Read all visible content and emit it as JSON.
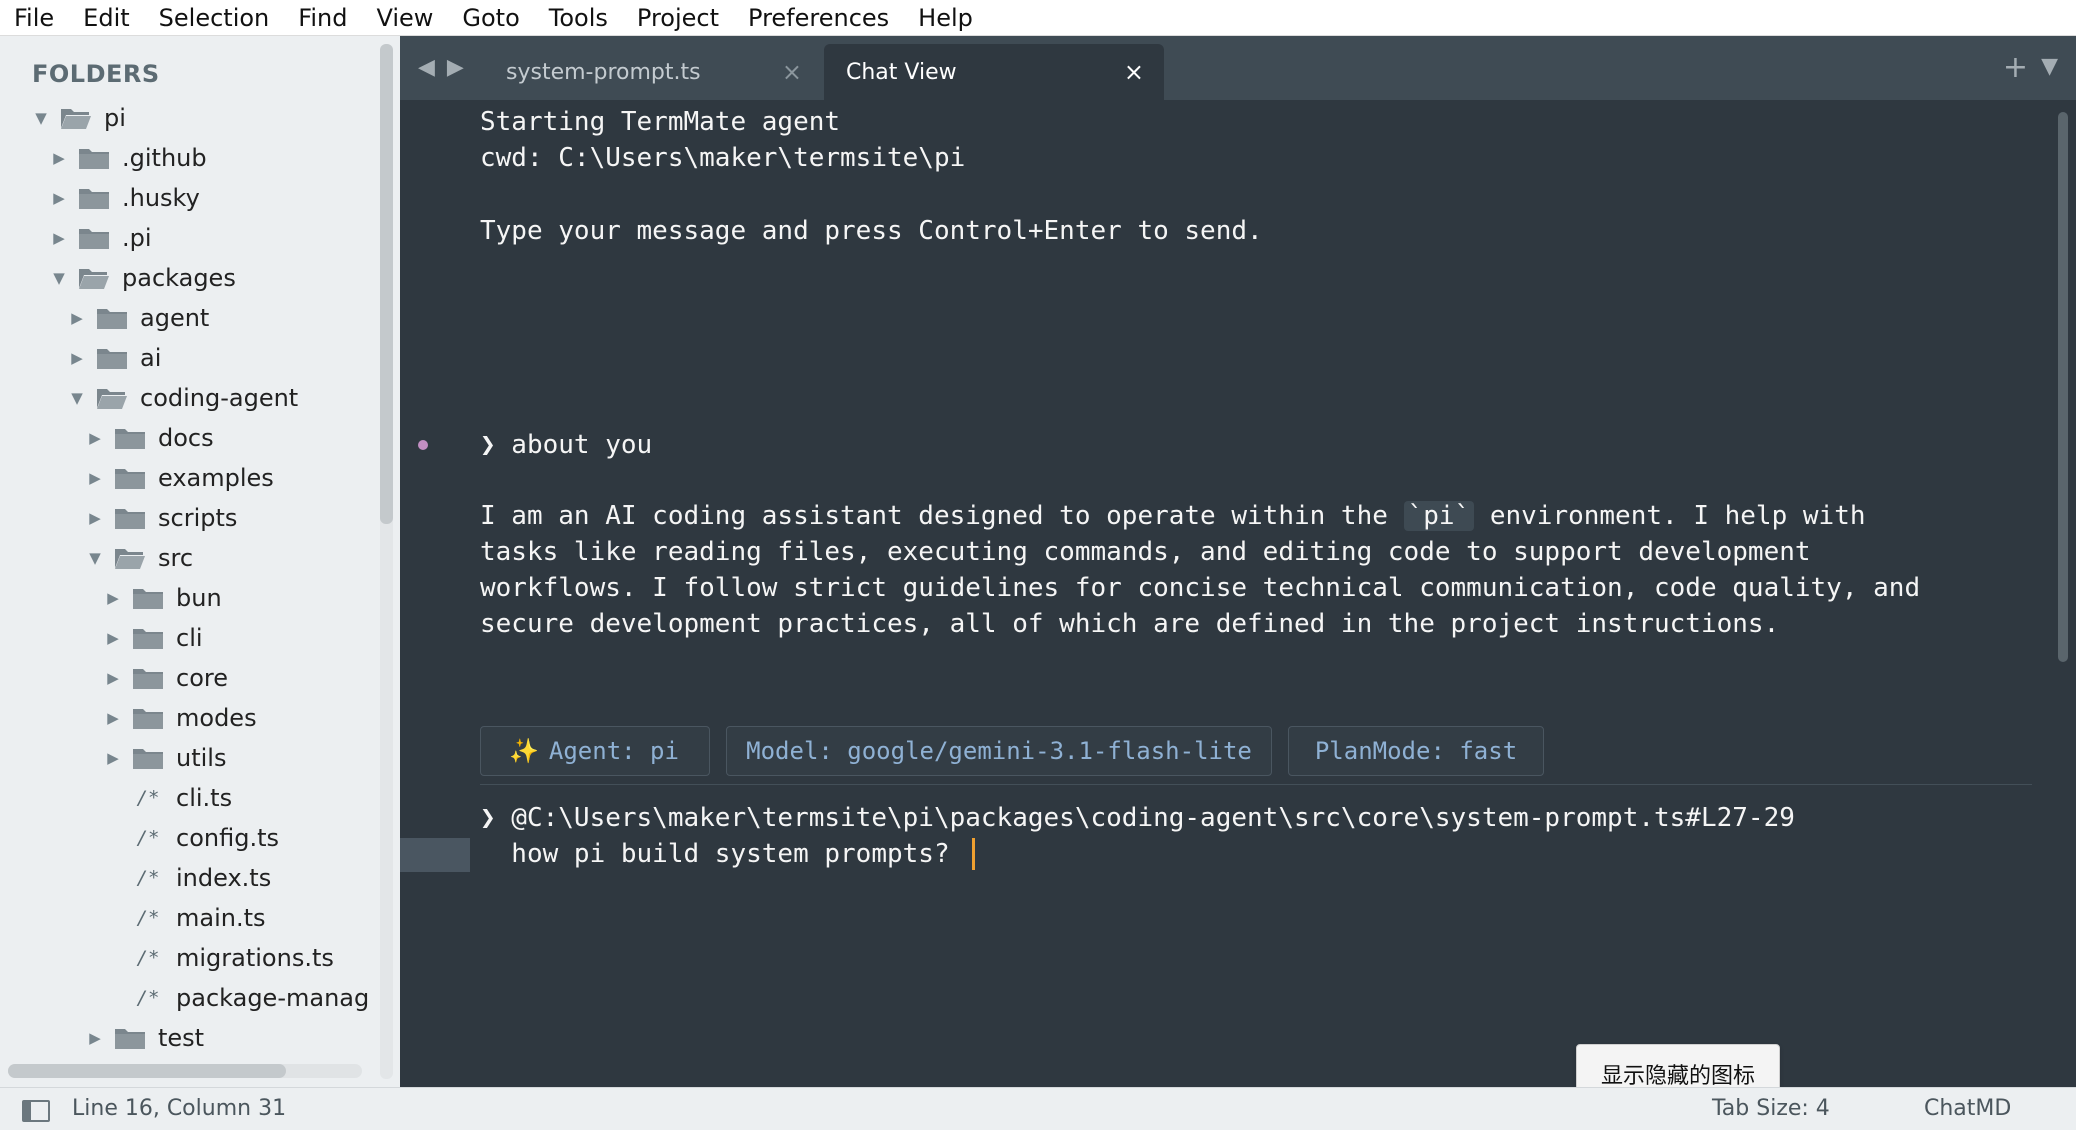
{
  "menu": [
    "File",
    "Edit",
    "Selection",
    "Find",
    "View",
    "Goto",
    "Tools",
    "Project",
    "Preferences",
    "Help"
  ],
  "sidebar": {
    "title": "FOLDERS",
    "tree": [
      {
        "label": "pi",
        "type": "folder",
        "depth": 0,
        "expanded": true
      },
      {
        "label": ".github",
        "type": "folder",
        "depth": 1,
        "expanded": false
      },
      {
        "label": ".husky",
        "type": "folder",
        "depth": 1,
        "expanded": false
      },
      {
        "label": ".pi",
        "type": "folder",
        "depth": 1,
        "expanded": false
      },
      {
        "label": "packages",
        "type": "folder",
        "depth": 1,
        "expanded": true
      },
      {
        "label": "agent",
        "type": "folder",
        "depth": 2,
        "expanded": false
      },
      {
        "label": "ai",
        "type": "folder",
        "depth": 2,
        "expanded": false
      },
      {
        "label": "coding-agent",
        "type": "folder",
        "depth": 2,
        "expanded": true
      },
      {
        "label": "docs",
        "type": "folder",
        "depth": 3,
        "expanded": false
      },
      {
        "label": "examples",
        "type": "folder",
        "depth": 3,
        "expanded": false
      },
      {
        "label": "scripts",
        "type": "folder",
        "depth": 3,
        "expanded": false
      },
      {
        "label": "src",
        "type": "folder",
        "depth": 3,
        "expanded": true
      },
      {
        "label": "bun",
        "type": "folder",
        "depth": 4,
        "expanded": false
      },
      {
        "label": "cli",
        "type": "folder",
        "depth": 4,
        "expanded": false
      },
      {
        "label": "core",
        "type": "folder",
        "depth": 4,
        "expanded": false
      },
      {
        "label": "modes",
        "type": "folder",
        "depth": 4,
        "expanded": false
      },
      {
        "label": "utils",
        "type": "folder",
        "depth": 4,
        "expanded": false
      },
      {
        "label": "cli.ts",
        "type": "file",
        "depth": 4
      },
      {
        "label": "config.ts",
        "type": "file",
        "depth": 4
      },
      {
        "label": "index.ts",
        "type": "file",
        "depth": 4
      },
      {
        "label": "main.ts",
        "type": "file",
        "depth": 4
      },
      {
        "label": "migrations.ts",
        "type": "file",
        "depth": 4
      },
      {
        "label": "package-manag",
        "type": "file",
        "depth": 4
      },
      {
        "label": "test",
        "type": "folder",
        "depth": 3,
        "expanded": false
      }
    ],
    "file_icon_glyph": "/*"
  },
  "tabs": {
    "nav_back": "◀",
    "nav_forward": "▶",
    "items": [
      {
        "label": "system-prompt.ts",
        "active": false,
        "close": "×"
      },
      {
        "label": "Chat View",
        "active": true,
        "close": "×"
      }
    ],
    "add": "+",
    "dropdown": "▼"
  },
  "editor": {
    "line_start": "Starting TermMate agent",
    "line_cwd": "cwd: C:\\Users\\maker\\termsite\\pi",
    "line_hint": "Type your message and press Control+Enter to send.",
    "question_prompt": "❯ about you",
    "answer": {
      "l1_pre": "I am an AI coding assistant designed to operate within the ",
      "l1_code": "`pi`",
      "l1_post": " environment. I help with",
      "l2": "tasks like reading files, executing commands, and editing code to support development",
      "l3": "workflows. I follow strict guidelines for concise technical communication, code quality, and",
      "l4": "secure development practices, all of which are defined in the project instructions."
    },
    "info": {
      "sparkle": "✨",
      "agent": "Agent: pi",
      "model": "Model: google/gemini-3.1-flash-lite",
      "plan": "PlanMode: fast"
    },
    "input_ref": "❯ @C:\\Users\\maker\\termsite\\pi\\packages\\coding-agent\\src\\core\\system-prompt.ts#L27-29",
    "input_text": "  how pi build system prompts?"
  },
  "tooltip": "显示隐藏的图标",
  "status": {
    "position": "Line 16, Column 31",
    "tab_size": "Tab Size: 4",
    "syntax": "ChatMD"
  },
  "colors": {
    "editor_bg": "#2f3840",
    "tabbar_bg": "#3f4b54",
    "sidebar_bg": "#eceff1",
    "info_text": "#8fb1d4",
    "cursor": "#f0a030",
    "bullet": "#c38fc3"
  }
}
